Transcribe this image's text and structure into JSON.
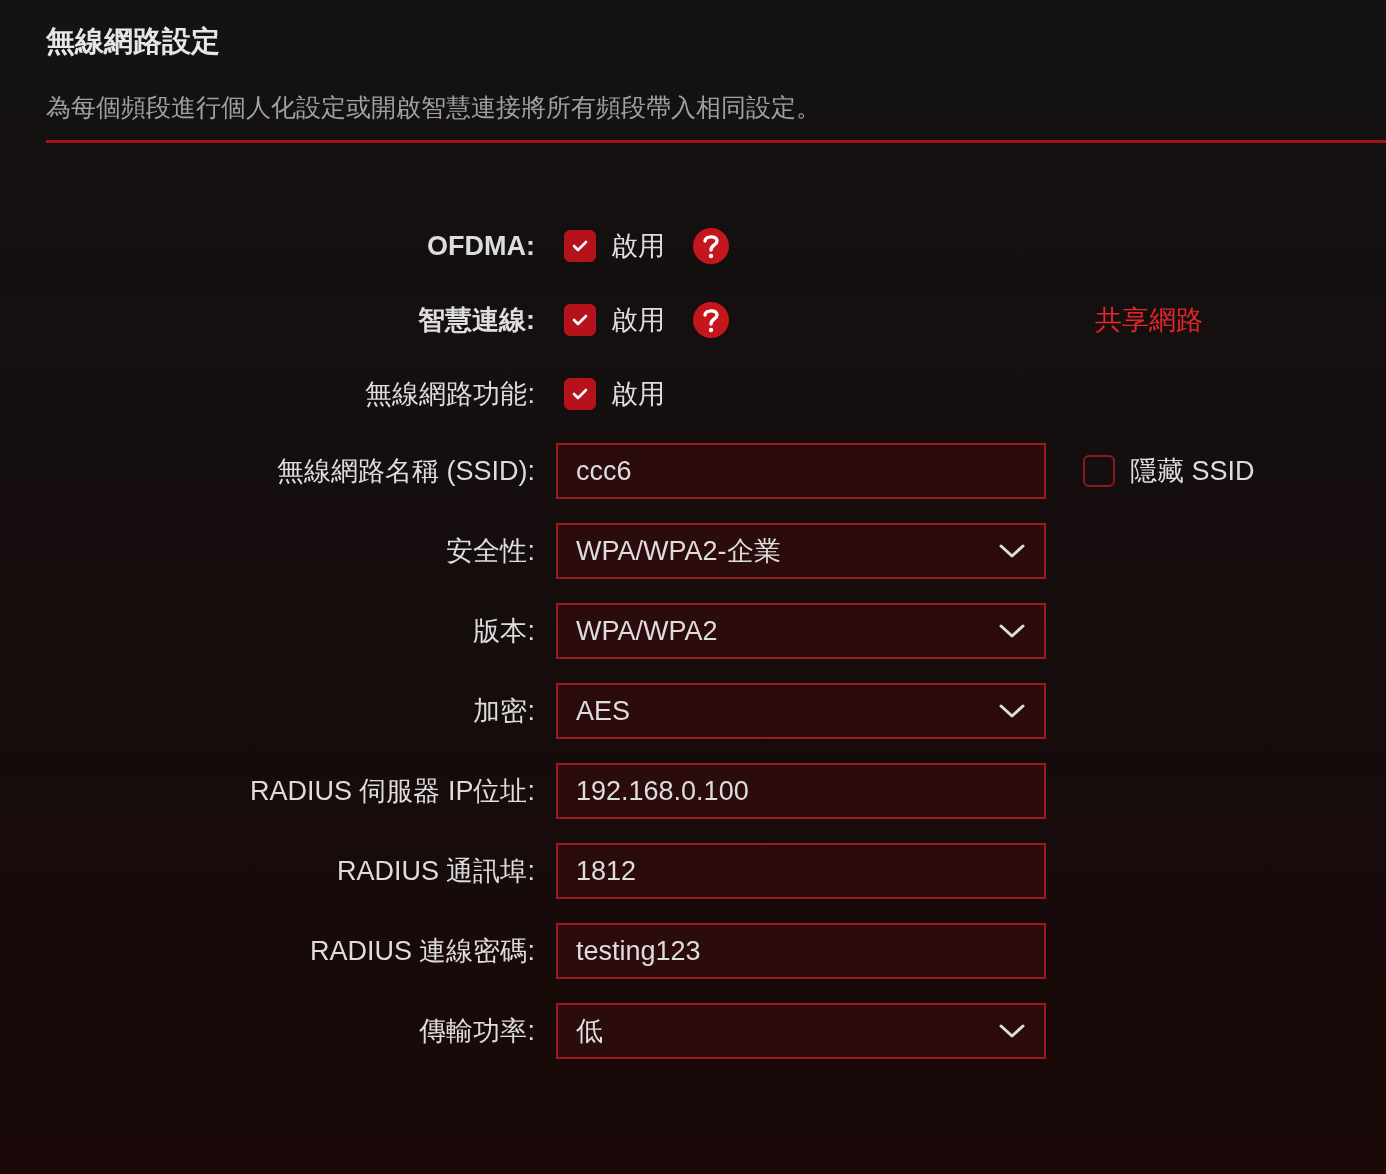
{
  "header": {
    "title": "無線網路設定",
    "description": "為每個頻段進行個人化設定或開啟智慧連接將所有頻段帶入相同設定。"
  },
  "rows": [
    {
      "kind": "checkbox",
      "label": "OFDMA:",
      "emphasized": true,
      "checked": true,
      "option": "啟用",
      "help": true
    },
    {
      "kind": "checkbox",
      "label": "智慧連線:",
      "emphasized": true,
      "checked": true,
      "option": "啟用",
      "help": true,
      "link": "共享網路"
    },
    {
      "kind": "checkbox",
      "label": "無線網路功能:",
      "emphasized": false,
      "checked": true,
      "option": "啟用",
      "help": false
    },
    {
      "kind": "text",
      "label": "無線網路名稱 (SSID):",
      "emphasized": false,
      "value": "ccc6",
      "extra": {
        "label": "隱藏 SSID",
        "checked": false
      }
    },
    {
      "kind": "select",
      "label": "安全性:",
      "emphasized": false,
      "value": "WPA/WPA2-企業"
    },
    {
      "kind": "select",
      "label": "版本:",
      "emphasized": false,
      "value": "WPA/WPA2"
    },
    {
      "kind": "select",
      "label": "加密:",
      "emphasized": false,
      "value": "AES"
    },
    {
      "kind": "text",
      "label": "RADIUS 伺服器 IP位址:",
      "emphasized": false,
      "value": "192.168.0.100"
    },
    {
      "kind": "text",
      "label": "RADIUS 通訊埠:",
      "emphasized": false,
      "value": "1812"
    },
    {
      "kind": "text",
      "label": "RADIUS 連線密碼:",
      "emphasized": false,
      "value": "testing123"
    },
    {
      "kind": "select",
      "label": "傳輸功率:",
      "emphasized": false,
      "value": "低"
    }
  ]
}
